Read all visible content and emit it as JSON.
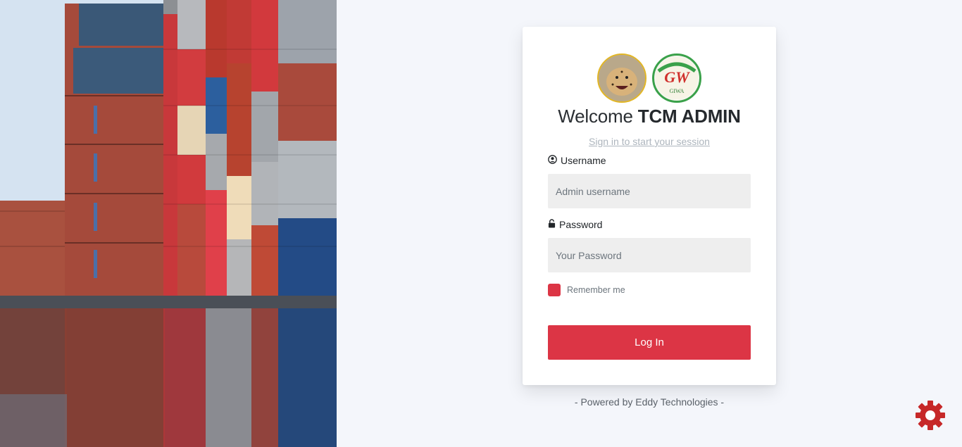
{
  "login": {
    "welcome_prefix": "Welcome",
    "welcome_name": "TCM ADMIN",
    "subtitle": "Sign in to start your session",
    "username_label": "Username",
    "username_placeholder": "Admin username",
    "password_label": "Password",
    "password_placeholder": "Your Password",
    "remember_label": "Remember me",
    "remember_checked": true,
    "login_button": "Log In"
  },
  "logos": {
    "left": "cheetah-logo",
    "right": "giwa-logo",
    "giwa_text_top": "GW",
    "giwa_text_bottom": "GIWA"
  },
  "footer": {
    "powered_by": "- Powered by Eddy Technologies -"
  },
  "icons": {
    "username": "user-circle-icon",
    "password": "lock-icon",
    "settings": "gear-icon"
  },
  "colors": {
    "accent": "#dc3545",
    "page_bg": "#f4f6fb",
    "settings_gear": "#c62828"
  }
}
